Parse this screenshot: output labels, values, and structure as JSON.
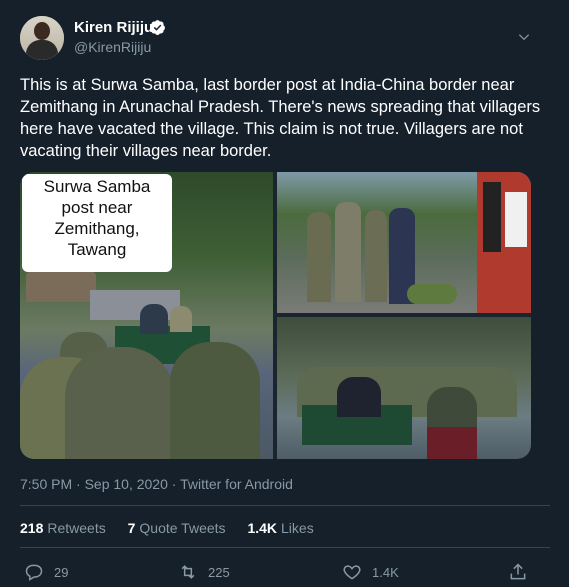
{
  "author": {
    "name": "Kiren Rijiju",
    "handle": "@KirenRijiju",
    "verified": true
  },
  "tweet": {
    "text": "This is at Surwa Samba, last border post at India-China border near Zemithang in Arunachal Pradesh. There's news spreading that villagers here have vacated the village. This claim is not true. Villagers are not vacating their villages near border."
  },
  "media": {
    "caption_lines": [
      "Surwa Samba",
      "post near",
      "Zemithang,",
      "Tawang"
    ]
  },
  "meta": {
    "timestamp": "7:50 PM · Sep 10, 2020 · Twitter for Android"
  },
  "stats": {
    "retweets_count": "218",
    "retweets_label": "Retweets",
    "quotes_count": "7",
    "quotes_label": "Quote Tweets",
    "likes_count": "1.4K",
    "likes_label": "Likes"
  },
  "actions": {
    "reply_count": "29",
    "retweet_count": "225",
    "like_count": "1.4K"
  },
  "colors": {
    "background": "#15202b",
    "secondary_text": "#8899a6",
    "divider": "#38444d",
    "verified_badge": "#ffffff"
  }
}
